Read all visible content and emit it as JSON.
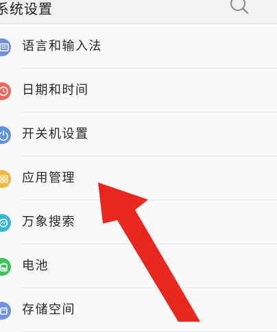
{
  "header": {
    "title": "系统设置",
    "search_icon": "search-icon"
  },
  "menu": {
    "items": [
      {
        "label": "语言和输入法",
        "icon": "keyboard-icon",
        "color": "#6f8fdc"
      },
      {
        "label": "日期和时间",
        "icon": "clock-icon",
        "color": "#e86a5a"
      },
      {
        "label": "开关机设置",
        "icon": "power-icon",
        "color": "#5d93e0"
      },
      {
        "label": "应用管理",
        "icon": "apps-icon",
        "color": "#f3b73c"
      },
      {
        "label": "万象搜索",
        "icon": "search-icon",
        "color": "#33b8d8"
      },
      {
        "label": "电池",
        "icon": "battery-icon",
        "color": "#3fc45b"
      },
      {
        "label": "存储空间",
        "icon": "storage-icon",
        "color": "#6c94e2"
      }
    ]
  },
  "annotation": {
    "arrow_color": "#e8281e",
    "points_to": "应用管理"
  }
}
